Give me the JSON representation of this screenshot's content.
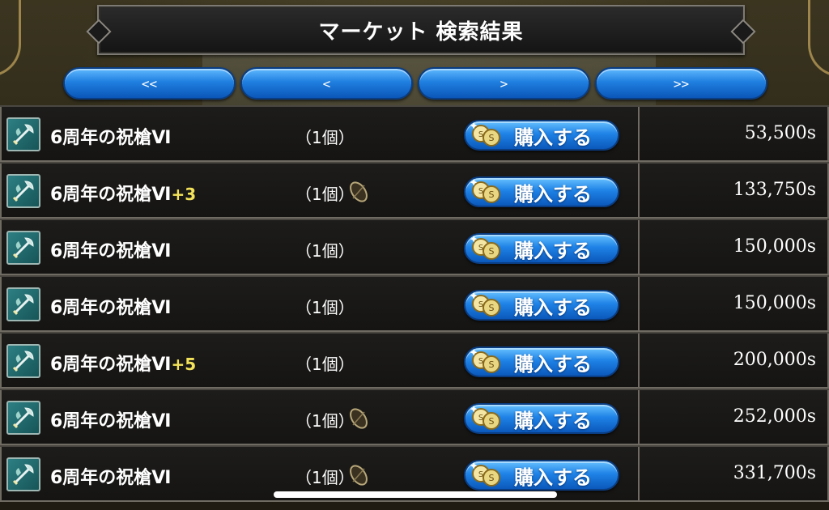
{
  "header": {
    "title": "マーケット 検索結果"
  },
  "pager": {
    "first_label": "<<",
    "prev_label": "<",
    "next_label": ">",
    "last_label": ">>"
  },
  "colors": {
    "button_blue": "#1f82e6",
    "plus_yellow": "#f3e35a",
    "row_bg": "#1a1917",
    "frame": "#6f6b63"
  },
  "icons": {
    "item": "axe-icon",
    "seed": "seed-icon",
    "coin": "coin-icon"
  },
  "items": [
    {
      "name": "6周年の祝槍Ⅵ",
      "plus": "",
      "qty": "（1個）",
      "has_seed": false,
      "buy_label": "購入する",
      "price": "53,500s"
    },
    {
      "name": "6周年の祝槍Ⅵ",
      "plus": "+3",
      "qty": "（1個）",
      "has_seed": true,
      "buy_label": "購入する",
      "price": "133,750s"
    },
    {
      "name": "6周年の祝槍Ⅵ",
      "plus": "",
      "qty": "（1個）",
      "has_seed": false,
      "buy_label": "購入する",
      "price": "150,000s"
    },
    {
      "name": "6周年の祝槍Ⅵ",
      "plus": "",
      "qty": "（1個）",
      "has_seed": false,
      "buy_label": "購入する",
      "price": "150,000s"
    },
    {
      "name": "6周年の祝槍Ⅵ",
      "plus": "+5",
      "qty": "（1個）",
      "has_seed": false,
      "buy_label": "購入する",
      "price": "200,000s"
    },
    {
      "name": "6周年の祝槍Ⅵ",
      "plus": "",
      "qty": "（1個）",
      "has_seed": true,
      "buy_label": "購入する",
      "price": "252,000s"
    },
    {
      "name": "6周年の祝槍Ⅵ",
      "plus": "",
      "qty": "（1個）",
      "has_seed": true,
      "buy_label": "購入する",
      "price": "331,700s"
    }
  ]
}
